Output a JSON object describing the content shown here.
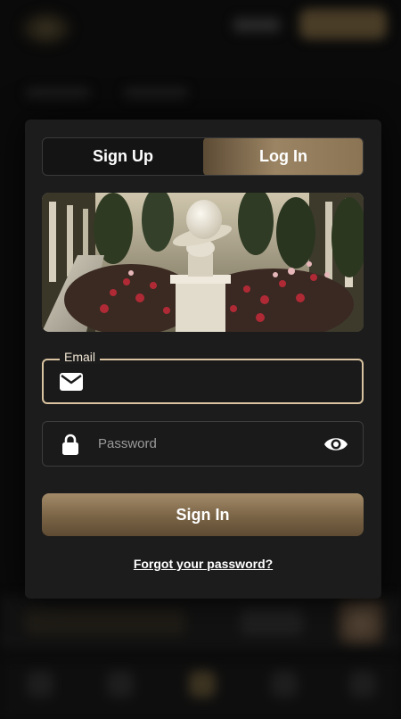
{
  "auth_tabs": {
    "signup_label": "Sign Up",
    "login_label": "Log In",
    "active": "login"
  },
  "email_field": {
    "label": "Email",
    "value": "",
    "placeholder": ""
  },
  "password_field": {
    "placeholder": "Password",
    "value": ""
  },
  "signin_button": {
    "label": "Sign In"
  },
  "forgot_link": {
    "label": "Forgot your password?"
  },
  "icons": {
    "email": "envelope-icon",
    "password": "lock-icon",
    "toggle": "eye-icon"
  },
  "colors": {
    "accent": "#9b8463",
    "modal_bg": "#1c1c1c",
    "focus_border": "#d9c3a0"
  }
}
